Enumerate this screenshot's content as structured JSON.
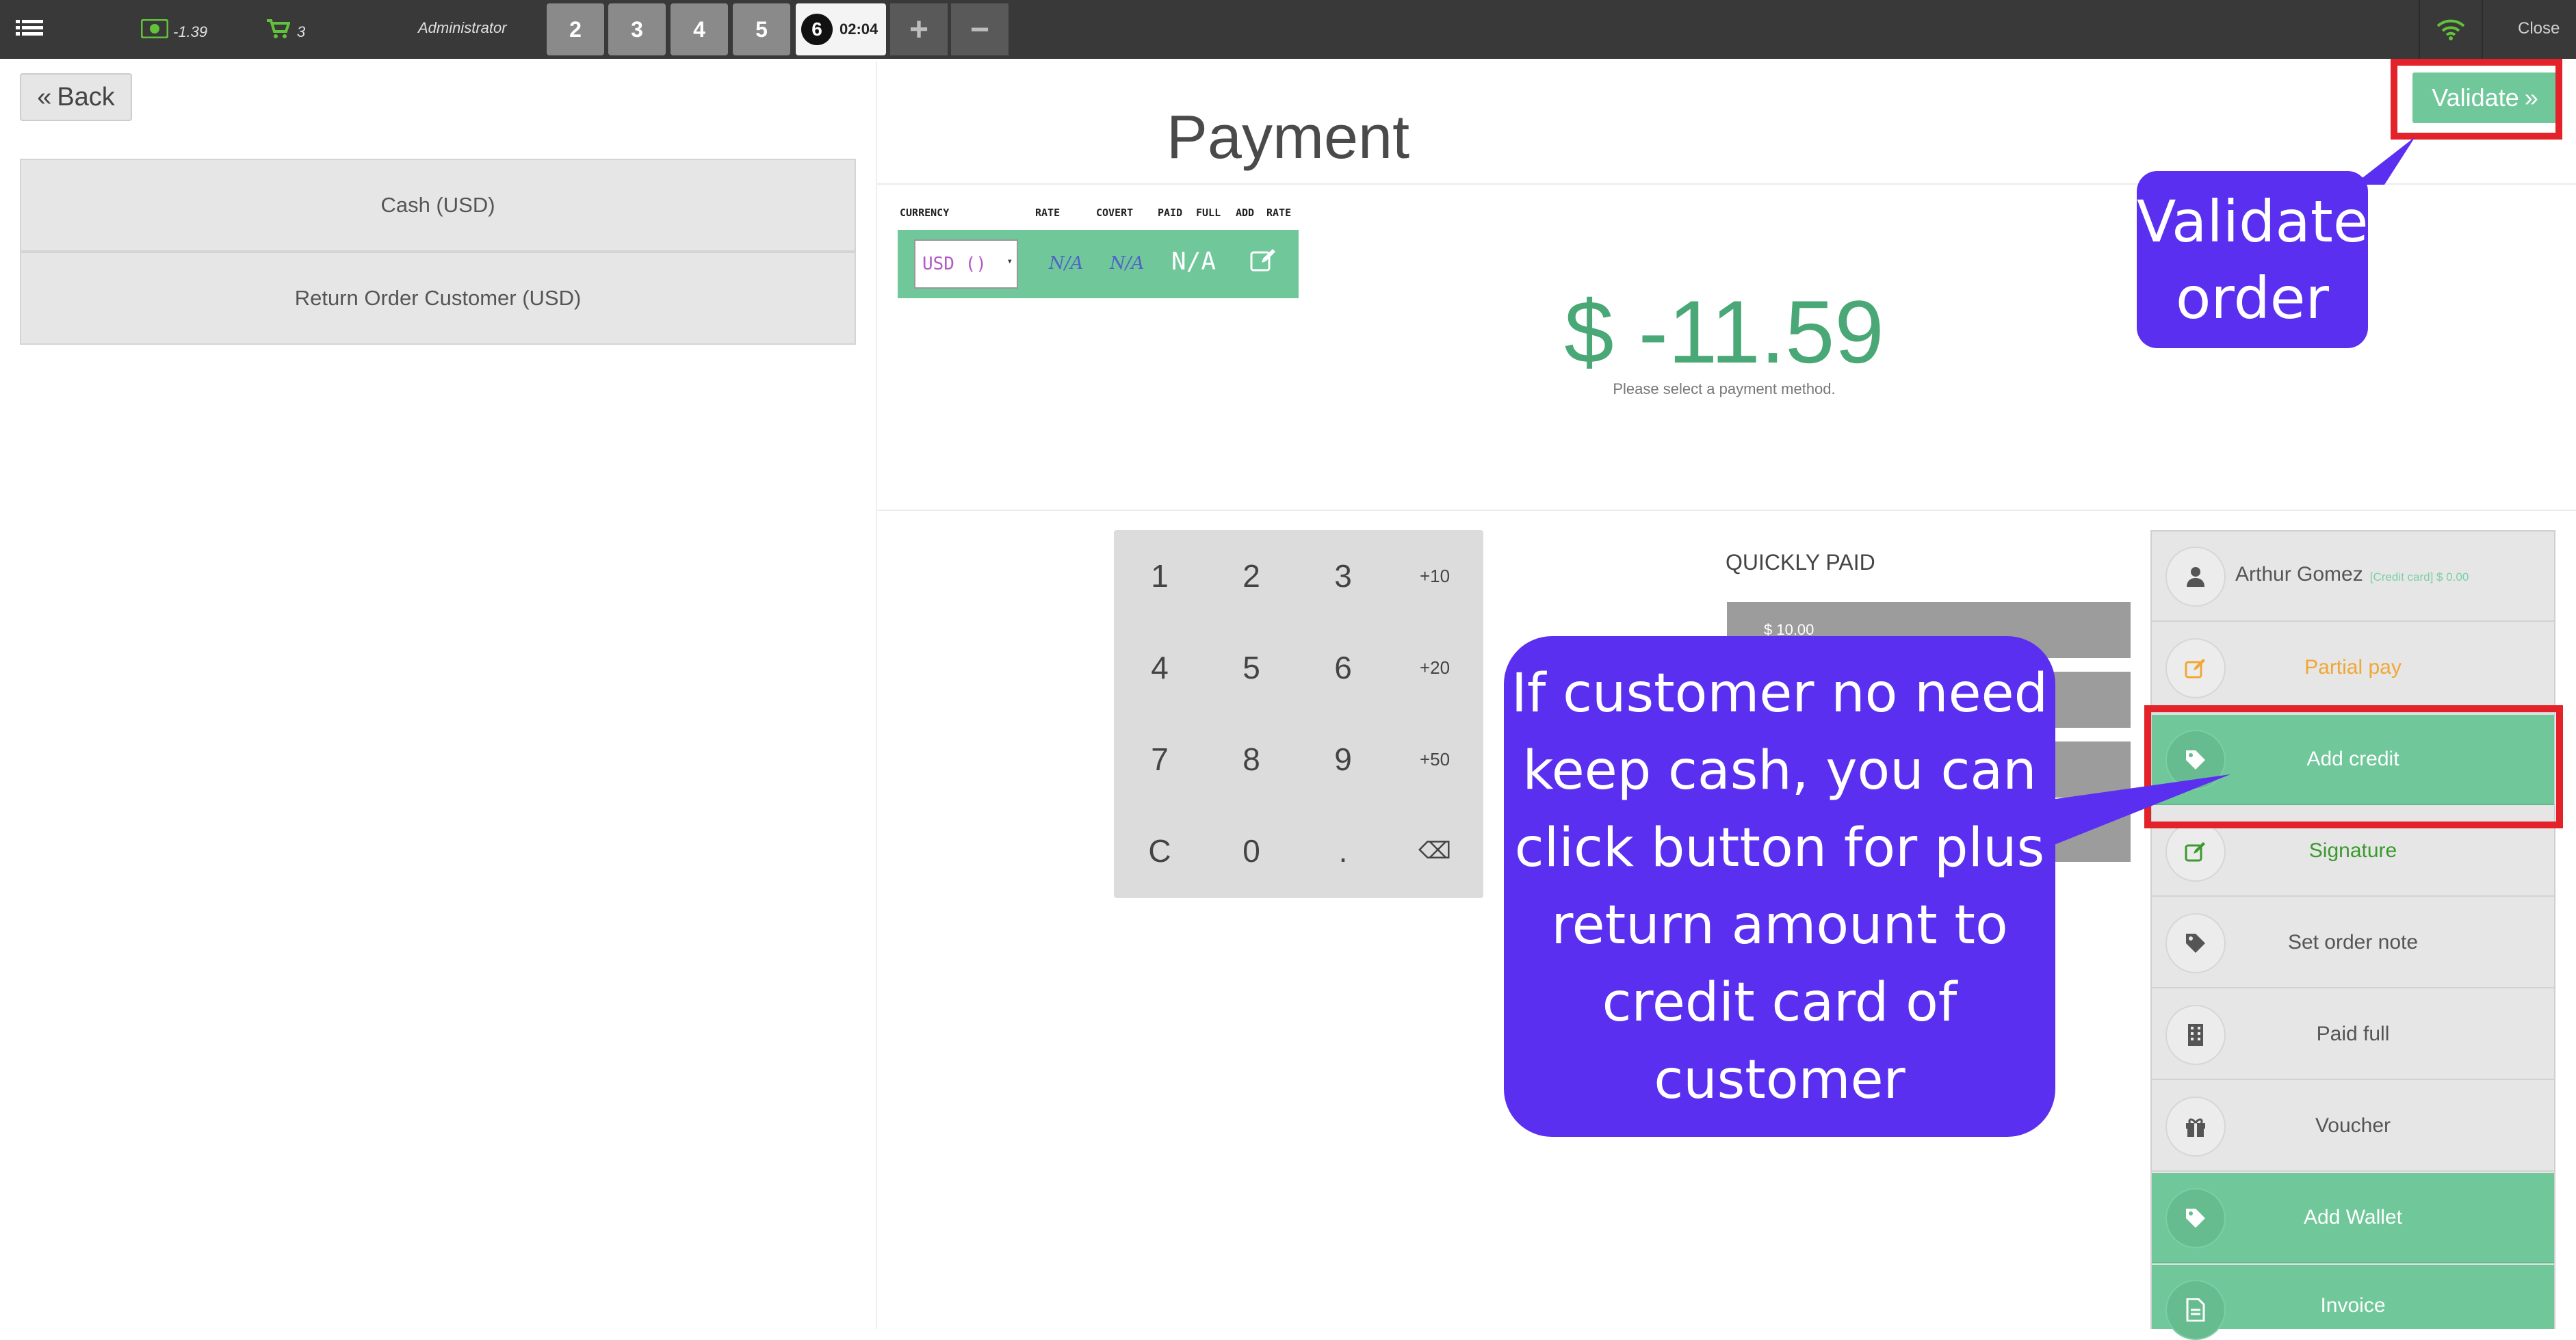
{
  "topbar": {
    "menu_icon": "list-icon",
    "cash_icon": "money-icon",
    "cash_value": "-1.39",
    "cart_icon": "cart-icon",
    "cart_count": "3",
    "user": "Administrator",
    "orders": [
      "2",
      "3",
      "4",
      "5"
    ],
    "active_order": {
      "number": "6",
      "time": "02:04"
    },
    "add_icon": "plus-icon",
    "remove_icon": "minus-icon",
    "wifi_icon": "wifi-icon",
    "close_label": "Close"
  },
  "back_label": "Back",
  "payment_methods": [
    "Cash (USD)",
    "Return Order Customer (USD)"
  ],
  "title": "Payment",
  "validate_label": "Validate",
  "currency_table": {
    "headers": [
      "CURRENCY",
      "RATE",
      "COVERT",
      "PAID",
      "FULL",
      "ADD",
      "RATE"
    ],
    "selected": "USD ()",
    "rate": "N/A",
    "covert": "N/A",
    "paid_full": "N/A",
    "edit_icon": "edit-icon"
  },
  "amount": "$ -11.59",
  "amount_message": "Please select a payment method.",
  "keypad": [
    "1",
    "2",
    "3",
    "+10",
    "4",
    "5",
    "6",
    "+20",
    "7",
    "8",
    "9",
    "+50",
    "C",
    "0",
    ".",
    "⌫"
  ],
  "quickly_paid": {
    "title": "QUICKLY PAID",
    "first": "$ 10.00"
  },
  "customer": {
    "name": "Arthur Gomez",
    "detail": "[Credit card] $ 0.00"
  },
  "actions": [
    {
      "label": "Partial pay",
      "icon": "edit-icon",
      "color": "#f0a733"
    },
    {
      "label": "Add credit",
      "icon": "tag-icon",
      "color": "#ffffff"
    },
    {
      "label": "Signature",
      "icon": "edit-icon",
      "color": "#3a9a2c"
    },
    {
      "label": "Set order note",
      "icon": "tag-icon",
      "color": "#555555"
    },
    {
      "label": "Paid full",
      "icon": "building-icon",
      "color": "#555555"
    },
    {
      "label": "Voucher",
      "icon": "gift-icon",
      "color": "#555555"
    },
    {
      "label": "Add Wallet",
      "icon": "tag-icon",
      "color": "#ffffff"
    },
    {
      "label": "Invoice",
      "icon": "file-icon",
      "color": "#ffffff"
    }
  ],
  "annotations": {
    "validate_callout": [
      "Validate",
      "order"
    ],
    "credit_callout": [
      "If customer no need",
      "keep cash, you can",
      "click button for plus",
      "return amount to",
      "credit card of",
      "customer"
    ]
  },
  "colors": {
    "accent": "#6fc79a",
    "callout": "#5b2ff0",
    "highlight": "#e3222a"
  }
}
